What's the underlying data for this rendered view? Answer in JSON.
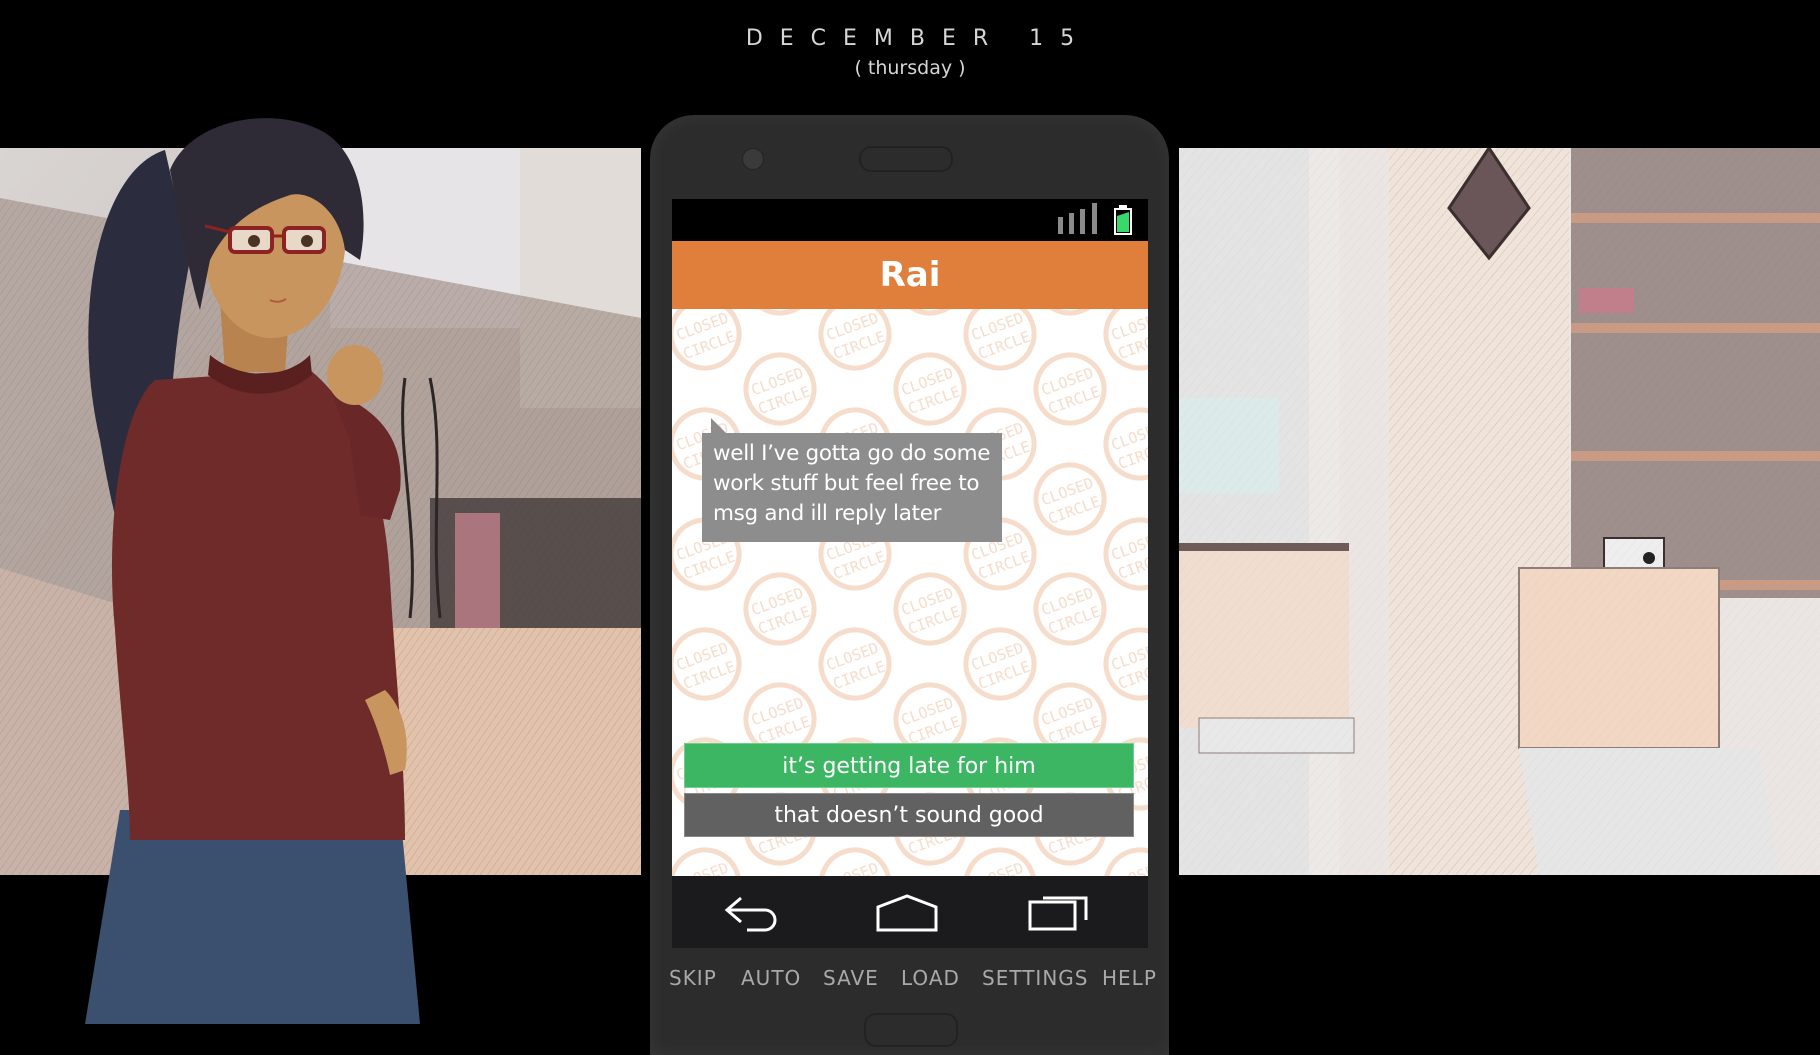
{
  "date": {
    "title": "DECEMBER 15",
    "weekday": "( thursday )"
  },
  "phone": {
    "status_bar": {
      "signal_icon": "signal-bars-icon",
      "signal_level": 4,
      "battery_icon": "battery-icon",
      "battery_level_percent": 75
    },
    "chat": {
      "contact_name": "Rai",
      "watermark_text": [
        "CLOSED",
        "CIRCLE"
      ],
      "messages": [
        {
          "from": "Rai",
          "lines": [
            "well I’ve gotta go do some",
            "work stuff but feel free to",
            "msg and ill reply later"
          ]
        }
      ],
      "choices": [
        {
          "label": "it’s getting late for him",
          "selected": true
        },
        {
          "label": "that doesn’t sound good",
          "selected": false
        }
      ]
    },
    "nav_bar": {
      "back_icon": "back-arrow-icon",
      "home_icon": "home-icon",
      "recents_icon": "recent-apps-icon"
    }
  },
  "menu": {
    "items": [
      "SKIP",
      "AUTO",
      "SAVE",
      "LOAD",
      "SETTINGS",
      "HELP"
    ]
  },
  "colors": {
    "header_orange": "#e07f3b",
    "choice_selected": "#3db663",
    "choice_default": "#616161",
    "bubble": "#8d8d8d",
    "battery_green": "#36d96a",
    "watermark": "#f6dccb",
    "menu_text": "#a9a9a9"
  }
}
